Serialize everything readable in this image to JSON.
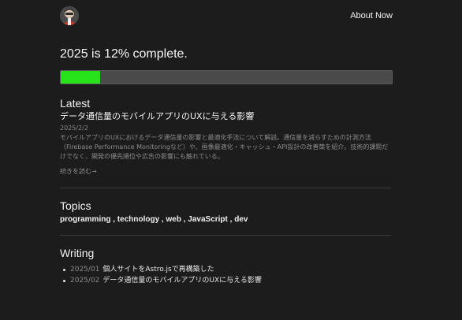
{
  "header": {
    "about_label": "About Now"
  },
  "progress": {
    "title": "2025 is 12% complete.",
    "percent": 12,
    "fill_color": "#27e31a"
  },
  "latest": {
    "heading": "Latest",
    "post": {
      "title": "データ通信量のモバイルアプリのUXに与える影響",
      "date": "2025/2/2",
      "excerpt": "モバイルアプリのUXにおけるデータ通信量の影響と最適化手法について解説。通信量を減らすための計測方法（Firebase Performance Monitoringなど）や、画像最適化・キャッシュ・API設計の改善策を紹介。技術的課題だけでなく、開発の優先順位や広告の影響にも触れている。",
      "read_more": "続きを読む→"
    }
  },
  "topics": {
    "heading": "Topics",
    "items": [
      "programming",
      "technology",
      "web",
      "JavaScript",
      "dev"
    ],
    "separator": " , "
  },
  "writing": {
    "heading": "Writing",
    "items": [
      {
        "date": "2025/01",
        "title": "個人サイトをAstro.jsで再構築した"
      },
      {
        "date": "2025/02",
        "title": "データ通信量のモバイルアプリのUXに与える影響"
      }
    ]
  },
  "icons": {
    "avatar": "avatar-icon"
  }
}
